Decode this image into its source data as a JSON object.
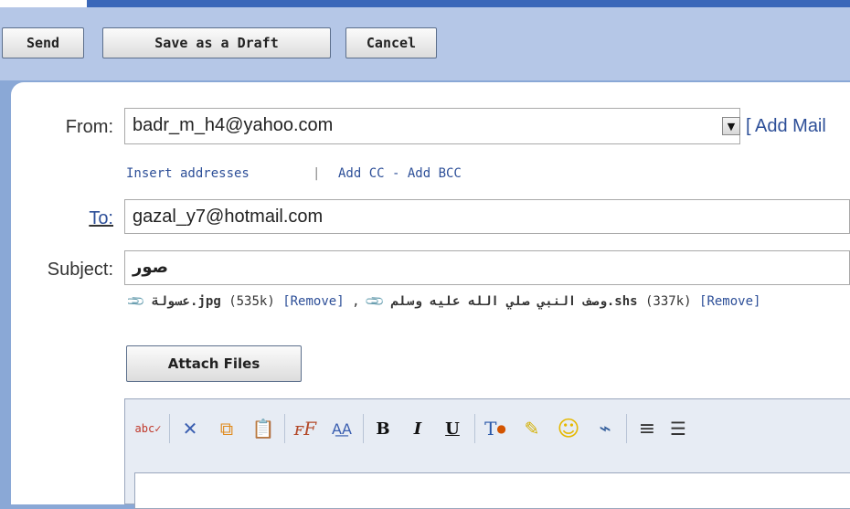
{
  "toolbar": {
    "send_label": "Send",
    "draft_label": "Save as a Draft",
    "cancel_label": "Cancel"
  },
  "from": {
    "label": "From:",
    "value": "badr_m_h4@yahoo.com",
    "add_mail_link": "[ Add Mail"
  },
  "address_links": {
    "insert": "Insert addresses",
    "separator": "|",
    "add_cc_bcc": "Add CC - Add BCC"
  },
  "to": {
    "label": "To:",
    "value": "gazal_y7@hotmail.com"
  },
  "subject": {
    "label": "Subject:",
    "value": "صور"
  },
  "attachments": [
    {
      "icon": "paperclip-icon",
      "name": "عسولة.jpg",
      "size": "(535k)",
      "remove": "[Remove]",
      "sep": ","
    },
    {
      "icon": "paperclip-icon",
      "name": "وصف النبي صلي الله عليه وسلم.shs",
      "size": "(337k)",
      "remove": "[Remove]",
      "sep": ""
    }
  ],
  "attach_button_label": "Attach Files",
  "editor_toolbar": [
    {
      "name": "spellcheck-icon",
      "glyph": "abc✓"
    },
    {
      "name": "cut-icon",
      "glyph": "✕"
    },
    {
      "name": "copy-icon",
      "glyph": "⧉"
    },
    {
      "name": "paste-icon",
      "glyph": "📋"
    },
    {
      "name": "font-icon",
      "glyph": "ꜰF"
    },
    {
      "name": "font-size-icon",
      "glyph": "A͟A"
    },
    {
      "name": "bold-icon",
      "glyph": "B"
    },
    {
      "name": "italic-icon",
      "glyph": "I"
    },
    {
      "name": "underline-icon",
      "glyph": "U"
    },
    {
      "name": "text-color-icon",
      "glyph": "T"
    },
    {
      "name": "highlight-icon",
      "glyph": "✎"
    },
    {
      "name": "emoticon-icon",
      "glyph": "☺"
    },
    {
      "name": "insert-link-icon",
      "glyph": "⌁"
    },
    {
      "name": "align-icon",
      "glyph": "≡"
    },
    {
      "name": "list-icon",
      "glyph": "☰"
    }
  ],
  "colors": {
    "link": "#2d4f98",
    "toolbar_bg": "#b5c7e7",
    "page_bg": "#8aa8d6"
  }
}
